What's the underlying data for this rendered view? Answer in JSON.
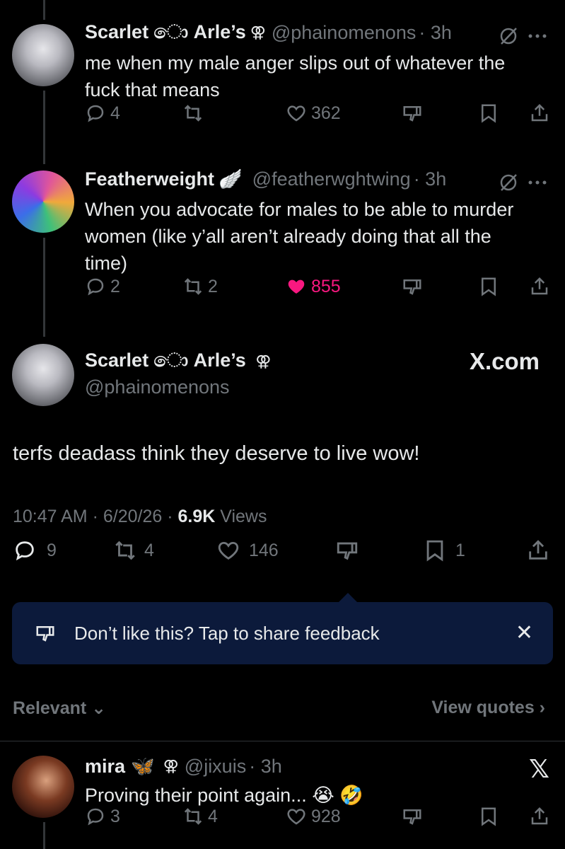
{
  "reply1": {
    "name": "Scarlet ො Arle’s",
    "symbol": "⚢",
    "handle": "@phainomenons",
    "time": "· 3h",
    "text": "me when my male anger slips out of whatever the fuck that means",
    "replies": "4",
    "reposts": "",
    "likes": "362"
  },
  "reply2": {
    "name": "Featherweight",
    "badge": "🪽",
    "handle": "@featherwghtwing",
    "time": "· 3h",
    "text": "When you advocate for males to be able to murder women (like y’all aren’t already doing that all the time)",
    "replies": "2",
    "reposts": "2",
    "likes": "855"
  },
  "main": {
    "name": "Scarlet ො Arle’s",
    "symbol": "⚢",
    "handle": "@phainomenons",
    "watermark": "X.com",
    "text": "terfs deadass think they deserve to live wow!",
    "time": "10:47 AM · 6/20/26 ·",
    "views": "6.9K",
    "views_label": "Views",
    "replies": "9",
    "reposts": "4",
    "likes": "146",
    "bookmarks": "1"
  },
  "feedback": {
    "text": "Don’t like this? Tap to share feedback",
    "close": "✕"
  },
  "sort": {
    "label": "Relevant ⌄",
    "quotes": "View quotes ›"
  },
  "reply3": {
    "name": "mira",
    "badge": "🦋",
    "symbol": "⚢",
    "handle": "@jixuis",
    "time": "· 3h",
    "text": "Proving their point again... 😭 🤣",
    "replies": "3",
    "reposts": "4",
    "likes": "928",
    "x_logo": "𝕏"
  },
  "colors": {
    "background": "#000000",
    "text": "#e7e9ea",
    "muted": "#71767b",
    "like": "#f91880",
    "feedback_bg": "#0c1a3b"
  }
}
